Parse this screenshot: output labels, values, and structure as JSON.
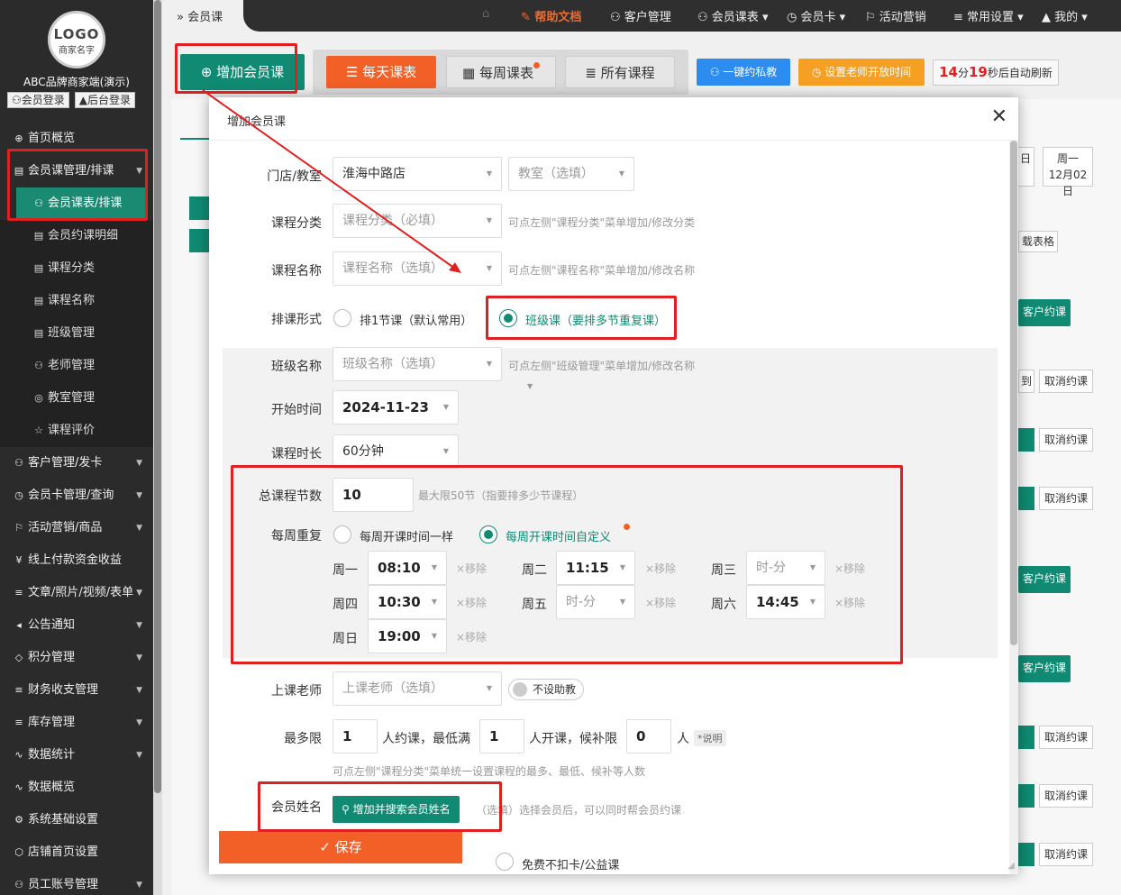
{
  "sidebar": {
    "logo_text": "LOGO",
    "logo_sub": "商家名字",
    "brand": "ABC品牌商家端(演示)",
    "member_login": "会员登录",
    "admin_login": "后台登录",
    "items": [
      {
        "label": "首页概览",
        "icon": "⊕"
      },
      {
        "label": "会员课管理/排课",
        "icon": "▤"
      },
      {
        "label": "会员课表/排课",
        "icon": "⚇"
      },
      {
        "label": "会员约课明细",
        "icon": "▤"
      },
      {
        "label": "课程分类",
        "icon": "▤"
      },
      {
        "label": "课程名称",
        "icon": "▤"
      },
      {
        "label": "班级管理",
        "icon": "▤"
      },
      {
        "label": "老师管理",
        "icon": "⚇"
      },
      {
        "label": "教室管理",
        "icon": "◎"
      },
      {
        "label": "课程评价",
        "icon": "☆"
      },
      {
        "label": "客户管理/发卡",
        "icon": "⚇"
      },
      {
        "label": "会员卡管理/查询",
        "icon": "◷"
      },
      {
        "label": "活动营销/商品",
        "icon": "⚐"
      },
      {
        "label": "线上付款资金收益",
        "icon": "¥"
      },
      {
        "label": "文章/照片/视频/表单",
        "icon": "≡"
      },
      {
        "label": "公告通知",
        "icon": "◂"
      },
      {
        "label": "积分管理",
        "icon": "◇"
      },
      {
        "label": "财务收支管理",
        "icon": "≡"
      },
      {
        "label": "库存管理",
        "icon": "≡"
      },
      {
        "label": "数据统计",
        "icon": "∿"
      },
      {
        "label": "数据概览",
        "icon": "∿"
      },
      {
        "label": "系统基础设置",
        "icon": "⚙"
      },
      {
        "label": "店铺首页设置",
        "icon": "⬡"
      },
      {
        "label": "员工账号管理",
        "icon": "⚇"
      }
    ]
  },
  "topbar": {
    "breadcrumb": "会员课",
    "nav": [
      "帮助文档",
      "客户管理",
      "会员课表",
      "会员卡",
      "活动营销",
      "常用设置",
      "我的"
    ]
  },
  "toolbar": {
    "add_course": "增加会员课",
    "daily": "每天课表",
    "weekly": "每周课表",
    "all": "所有课程",
    "private": "一键约私教",
    "teacher_time": "设置老师开放时间",
    "refresh_min": "14",
    "refresh_min_unit": "分",
    "refresh_sec": "19",
    "refresh_suffix": "秒后自动刷新"
  },
  "background": {
    "day_label": "周一",
    "day_date": "12月02日",
    "day_prev": "日",
    "download": "载表格",
    "customer_book": "客户约课",
    "cancel": "取消约课",
    "checkin": "到"
  },
  "modal": {
    "title": "增加会员课",
    "store_label": "门店/教室",
    "store_value": "淮海中路店",
    "room_placeholder": "教室（选填）",
    "category_label": "课程分类",
    "category_placeholder": "课程分类（必填）",
    "category_hint": "可点左侧\"课程分类\"菜单增加/修改分类",
    "name_label": "课程名称",
    "name_placeholder": "课程名称（选填）",
    "name_hint": "可点左侧\"课程名称\"菜单增加/修改名称",
    "form_label": "排课形式",
    "form_option1": "排1节课（默认常用）",
    "form_option2": "班级课（要排多节重复课）",
    "class_label": "班级名称",
    "class_placeholder": "班级名称（选填）",
    "class_hint": "可点左侧\"班级管理\"菜单增加/修改名称",
    "start_label": "开始时间",
    "start_value": "2024-11-23",
    "duration_label": "课程时长",
    "duration_value": "60分钟",
    "total_label": "总课程节数",
    "total_value": "10",
    "total_hint": "最大限50节（指要排多少节课程）",
    "repeat_label": "每周重复",
    "repeat_option1": "每周开课时间一样",
    "repeat_option2": "每周开课时间自定义",
    "remove_label": "×移除",
    "time_placeholder": "时-分",
    "days": [
      {
        "day": "周一",
        "time": "08:10"
      },
      {
        "day": "周二",
        "time": "11:15"
      },
      {
        "day": "周三",
        "time": ""
      },
      {
        "day": "周四",
        "time": "10:30"
      },
      {
        "day": "周五",
        "time": ""
      },
      {
        "day": "周六",
        "time": "14:45"
      },
      {
        "day": "周日",
        "time": "19:00"
      }
    ],
    "teacher_label": "上课老师",
    "teacher_placeholder": "上课老师（选填）",
    "private_toggle": "不设助教",
    "limit_label": "最多限",
    "limit_max": "1",
    "limit_text1": "人约课，最低满",
    "limit_min": "1",
    "limit_text2": "人开课，候补限",
    "limit_wait": "0",
    "limit_text3": "人",
    "limit_note": "*说明",
    "limit_hint": "可点左侧\"课程分类\"菜单统一设置课程的最多、最低、候补等人数",
    "member_label": "会员姓名",
    "member_button": "增加并搜索会员姓名",
    "member_hint": "（选填）选择会员后，可以同时帮会员约课",
    "free_label": "免费不扣卡/公益课",
    "save_button": "保存"
  },
  "colors": {
    "primary": "#108a72",
    "orange": "#f25f27",
    "highlight": "#e02020",
    "blue": "#2d8cf0",
    "amber": "#f5a023"
  }
}
